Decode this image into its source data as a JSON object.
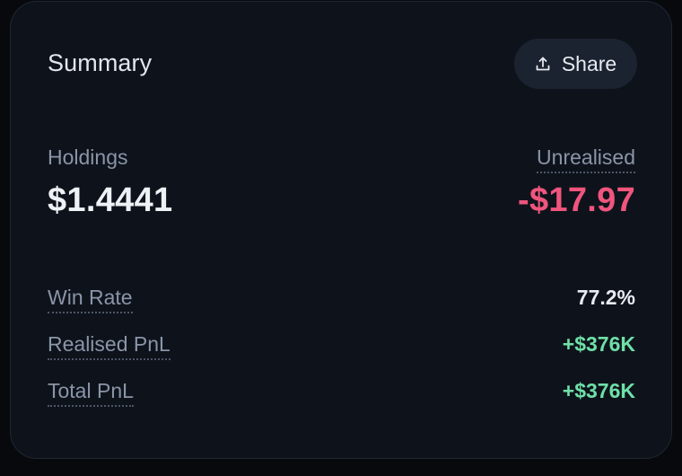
{
  "summary": {
    "title": "Summary",
    "share_label": "Share",
    "holdings_label": "Holdings",
    "holdings_value": "$1.4441",
    "unrealised_label": "Unrealised",
    "unrealised_value": "-$17.97",
    "stats": [
      {
        "label": "Win Rate",
        "value": "77.2%"
      },
      {
        "label": "Realised PnL",
        "value": "+$376K"
      },
      {
        "label": "Total PnL",
        "value": "+$376K"
      }
    ]
  },
  "colors": {
    "card_bg": "#0e131b",
    "negative": "#f0557d",
    "positive": "#6fe0a8",
    "muted_label": "#8a95a8"
  },
  "icons": {
    "share": "upload-icon"
  }
}
